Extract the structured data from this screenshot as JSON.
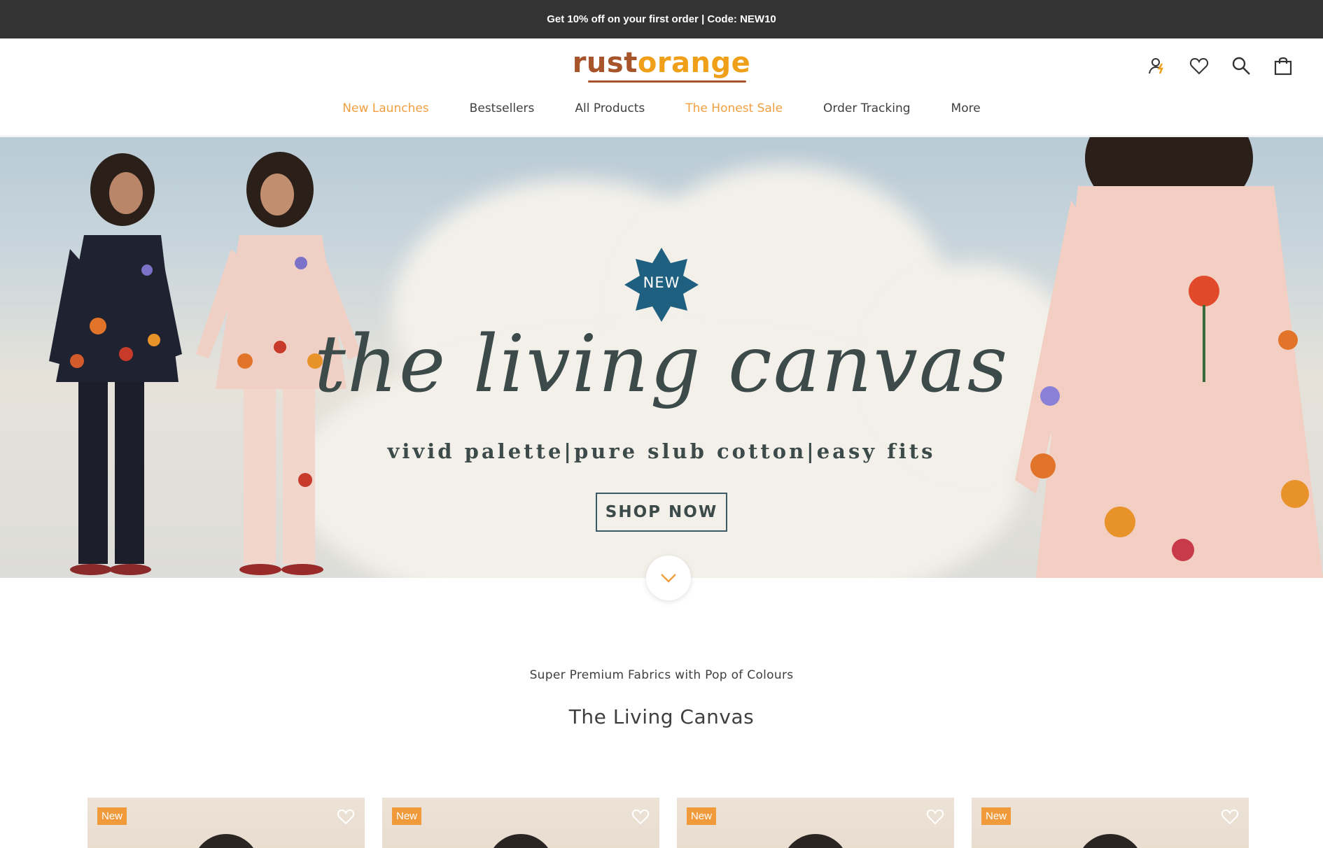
{
  "announcement": {
    "text": "Get 10% off on your first order | Code: NEW10"
  },
  "header": {
    "logo": {
      "part1": "rust",
      "part2": "orange"
    },
    "icons": [
      "account-icon",
      "wishlist-icon",
      "search-icon",
      "cart-icon"
    ],
    "nav": [
      {
        "label": "New Launches",
        "accent": true
      },
      {
        "label": "Bestsellers",
        "accent": false
      },
      {
        "label": "All Products",
        "accent": false
      },
      {
        "label": "The Honest Sale",
        "accent": true
      },
      {
        "label": "Order Tracking",
        "accent": false
      },
      {
        "label": "More",
        "accent": false
      }
    ]
  },
  "hero": {
    "badge": "NEW",
    "title": "the living canvas",
    "subtitle": "vivid palette|pure slub cotton|easy fits",
    "cta": "SHOP NOW"
  },
  "section": {
    "subtitle": "Super Premium Fabrics with Pop of Colours",
    "title": "The Living Canvas"
  },
  "products": [
    {
      "tag": "New"
    },
    {
      "tag": "New"
    },
    {
      "tag": "New"
    },
    {
      "tag": "New"
    }
  ],
  "colors": {
    "brand_rust": "#a8542a",
    "brand_orange": "#f0a018",
    "accent_nav": "#f0a040",
    "tag_bg": "#f09a3c",
    "announce_bg": "#333333",
    "badge_blue": "#1f5f80"
  }
}
